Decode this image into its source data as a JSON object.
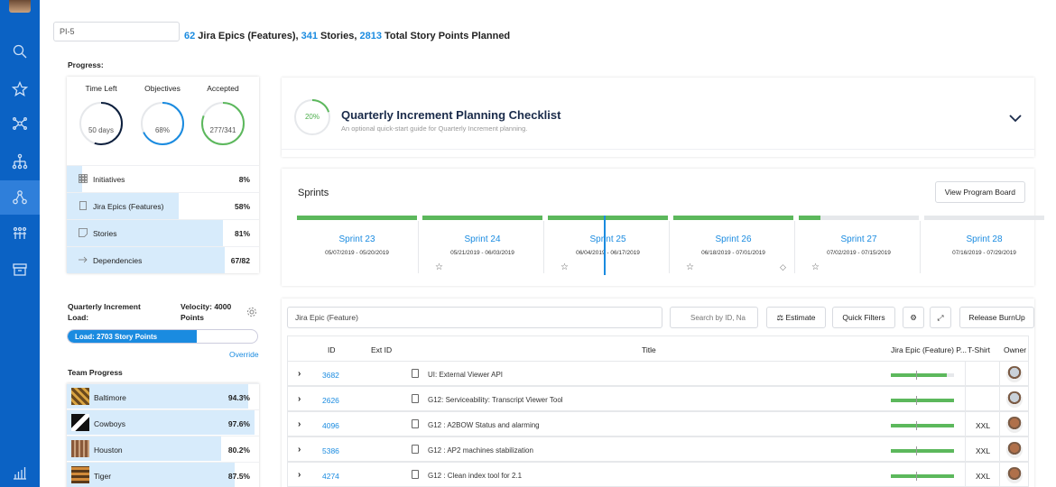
{
  "pi": {
    "value": "PI-5"
  },
  "summary": {
    "epics": "62",
    "epics_label": " Jira Epics (Features), ",
    "stories": "341",
    "stories_label": " Stories, ",
    "points": "2813",
    "points_label": " Total Story Points Planned"
  },
  "progress": {
    "heading": "Progress:",
    "gauges": [
      {
        "title": "Time Left",
        "value": "50 days",
        "fraction": 0.55,
        "color": "#0d1f3d"
      },
      {
        "title": "Objectives",
        "value": "68%",
        "fraction": 0.68,
        "color": "#1a8be0"
      },
      {
        "title": "Accepted",
        "value": "277/341",
        "fraction": 0.81,
        "color": "#5cb85c"
      }
    ],
    "rows": [
      {
        "label": "Initiatives",
        "value": "8%",
        "fraction": 0.08,
        "icon": "grid-icon"
      },
      {
        "label": "Jira Epics (Features)",
        "value": "58%",
        "fraction": 0.58,
        "icon": "document-icon"
      },
      {
        "label": "Stories",
        "value": "81%",
        "fraction": 0.81,
        "icon": "story-icon"
      },
      {
        "label": "Dependencies",
        "value": "67/82",
        "fraction": 0.82,
        "icon": "dependency-icon"
      }
    ]
  },
  "qi_load": {
    "title_line1": "Quarterly Increment",
    "title_line2": "Load:",
    "velocity_line1": "Velocity: 4000",
    "velocity_line2": "Points",
    "bar_label": "Load: 2703 Story Points",
    "fraction": 0.68,
    "override": "Override"
  },
  "team_progress": {
    "heading": "Team Progress",
    "teams": [
      {
        "name": "Baltimore",
        "value": "94.3%",
        "fraction": 0.943
      },
      {
        "name": "Cowboys",
        "value": "97.6%",
        "fraction": 0.976
      },
      {
        "name": "Houston",
        "value": "80.2%",
        "fraction": 0.802
      },
      {
        "name": "Tiger",
        "value": "87.5%",
        "fraction": 0.875
      }
    ]
  },
  "checklist": {
    "percent": "20%",
    "fraction": 0.2,
    "title": "Quarterly Increment Planning Checklist",
    "subtitle": "An optional quick-start guide for Quarterly Increment planning."
  },
  "sprints": {
    "title": "Sprints",
    "view_button": "View Program Board",
    "items": [
      {
        "name": "Sprint 23",
        "dates": "05/07/2019 - 05/20/2019",
        "fraction": 1.0
      },
      {
        "name": "Sprint 24",
        "dates": "05/21/2019 - 06/03/2019",
        "fraction": 1.0
      },
      {
        "name": "Sprint 25",
        "dates": "06/04/2019 - 06/17/2019",
        "fraction": 1.0
      },
      {
        "name": "Sprint 26",
        "dates": "06/18/2019 - 07/01/2019",
        "fraction": 1.0
      },
      {
        "name": "Sprint 27",
        "dates": "07/02/2019 - 07/15/2019",
        "fraction": 0.18
      },
      {
        "name": "Sprint 28",
        "dates": "07/16/2019 - 07/29/2019",
        "fraction": 0.0
      }
    ]
  },
  "epics": {
    "selector": "Jira Epic (Feature)",
    "search_placeholder": "Search by ID, Na",
    "estimate": "Estimate",
    "quick_filters": "Quick Filters",
    "release_burnup": "Release BurnUp",
    "columns": {
      "id": "ID",
      "ext_id": "Ext ID",
      "title": "Title",
      "progress": "Jira Epic (Feature) P...",
      "tshirt": "T-Shirt",
      "owner": "Owner"
    },
    "rows": [
      {
        "id": "3682",
        "title": "UI: External Viewer API",
        "progress": 0.88,
        "tshirt": "",
        "owner_color": "#c9d1d9"
      },
      {
        "id": "2626",
        "title": "G12: Serviceability: Transcript Viewer Tool",
        "progress": 1.0,
        "tshirt": "",
        "owner_color": "#c9d1d9"
      },
      {
        "id": "4096",
        "title": "G12 : A2BOW Status and alarming",
        "progress": 1.0,
        "tshirt": "XXL",
        "owner_color": "#b0704a"
      },
      {
        "id": "5386",
        "title": "G12 : AP2 machines stabilization",
        "progress": 1.0,
        "tshirt": "XXL",
        "owner_color": "#b0704a"
      },
      {
        "id": "4274",
        "title": "G12 : Clean index tool for 2.1",
        "progress": 1.0,
        "tshirt": "XXL",
        "owner_color": "#b0704a"
      }
    ]
  }
}
